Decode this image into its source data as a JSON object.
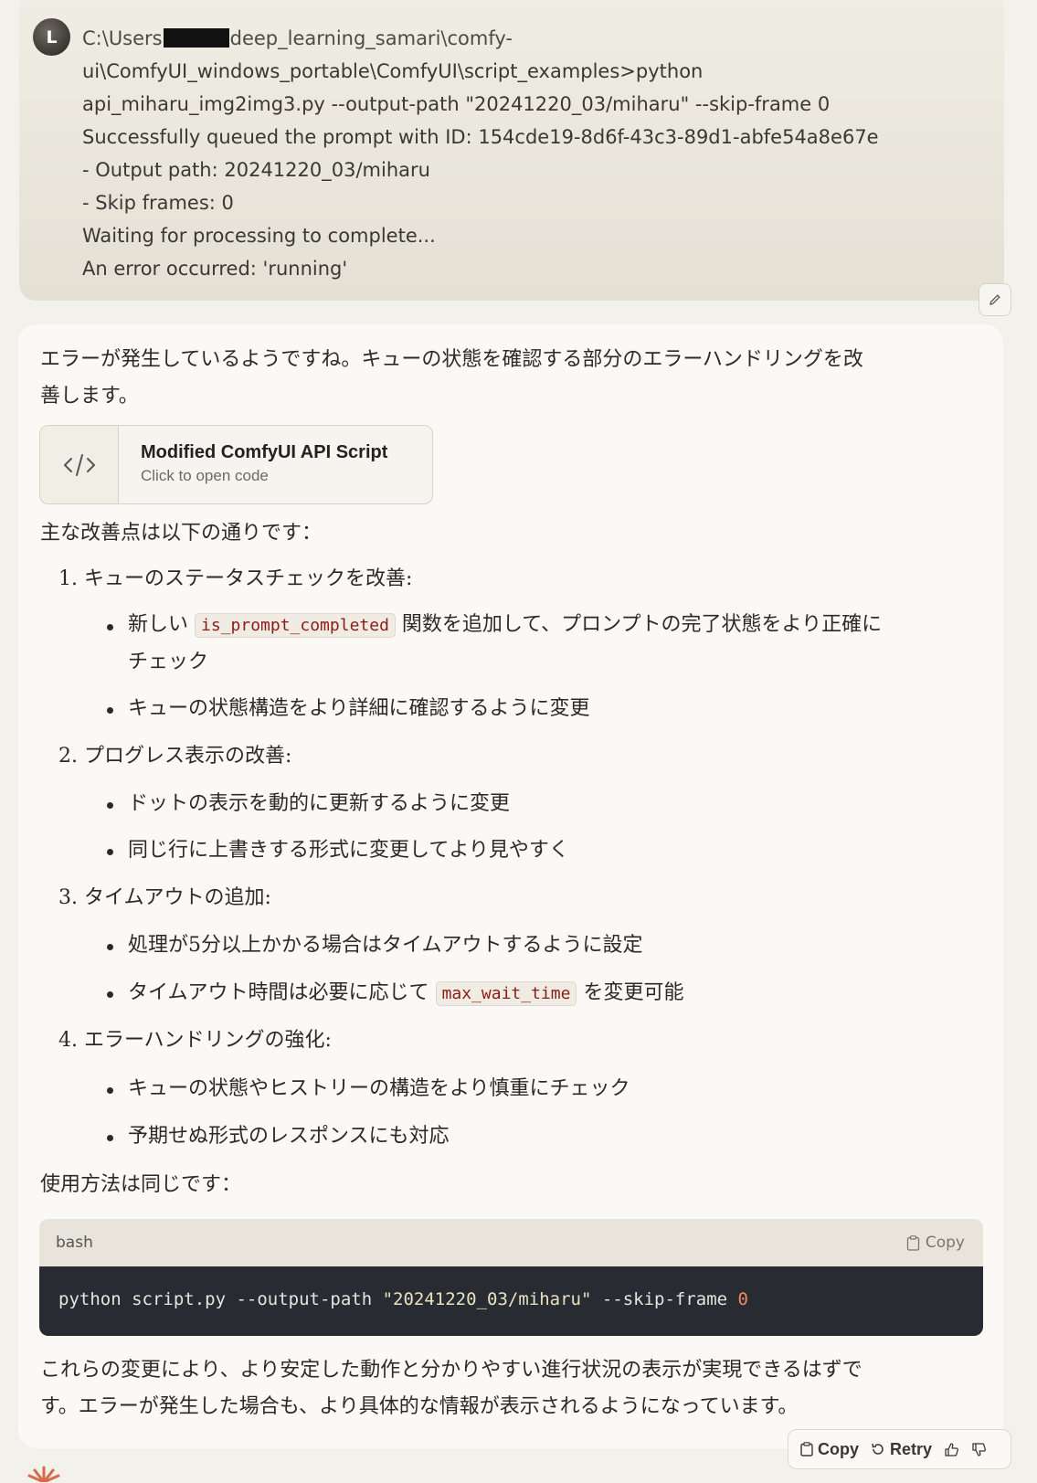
{
  "user": {
    "avatar_initial": "L",
    "lines": [
      {
        "pre": "C:\\Users",
        "post": "deep_learning_samari\\comfy-"
      },
      "ui\\ComfyUI_windows_portable\\ComfyUI\\script_examples>python",
      "api_miharu_img2img3.py --output-path \"20241220_03/miharu\" --skip-frame 0",
      "Successfully queued the prompt with ID: 154cde19-8d6f-43c3-89d1-abfe54a8e67e",
      "- Output path: 20241220_03/miharu",
      "- Skip frames: 0",
      "Waiting for processing to complete...",
      "An error occurred: 'running'"
    ]
  },
  "assistant": {
    "intro_line1": "エラーが発生しているようですね。キューの状態を確認する部分のエラーハンドリングを改",
    "intro_line2": "善します。",
    "artifact": {
      "title": "Modified ComfyUI API Script",
      "subtitle": "Click to open code"
    },
    "improvements_lead": "主な改善点は以下の通りです：",
    "items": [
      {
        "num": "1.",
        "title": "キューのステータスチェックを改善:"
      },
      {
        "num": "2.",
        "title": "プログレス表示の改善:"
      },
      {
        "num": "3.",
        "title": "タイムアウトの追加:"
      },
      {
        "num": "4.",
        "title": "エラーハンドリングの強化:"
      }
    ],
    "b1a_pre": "新しい",
    "b1a_code": "is_prompt_completed",
    "b1a_post": "関数を追加して、プロンプトの完了状態をより正確に",
    "b1a_cont": "チェック",
    "b1b": "キューの状態構造をより詳細に確認するように変更",
    "b2a": "ドットの表示を動的に更新するように変更",
    "b2b": "同じ行に上書きする形式に変更してより見やすく",
    "b3a": "処理が5分以上かかる場合はタイムアウトするように設定",
    "b3b_pre": "タイムアウト時間は必要に応じて",
    "b3b_code": "max_wait_time",
    "b3b_post": "を変更可能",
    "b4a": "キューの状態やヒストリーの構造をより慎重にチェック",
    "b4b": "予期せぬ形式のレスポンスにも対応",
    "usage_lead": "使用方法は同じです：",
    "code": {
      "lang": "bash",
      "copy_label": "Copy",
      "cmd": "python script.py --output-path ",
      "str": "\"20241220_03/miharu\"",
      "flag": " --skip-frame ",
      "num": "0"
    },
    "closing_line1": "これらの変更により、より安定した動作と分かりやすい進行状況の表示が実現できるはずで",
    "closing_line2": "す。エラーが発生した場合も、より具体的な情報が表示されるようになっています。"
  },
  "actions": {
    "copy": "Copy",
    "retry": "Retry"
  }
}
